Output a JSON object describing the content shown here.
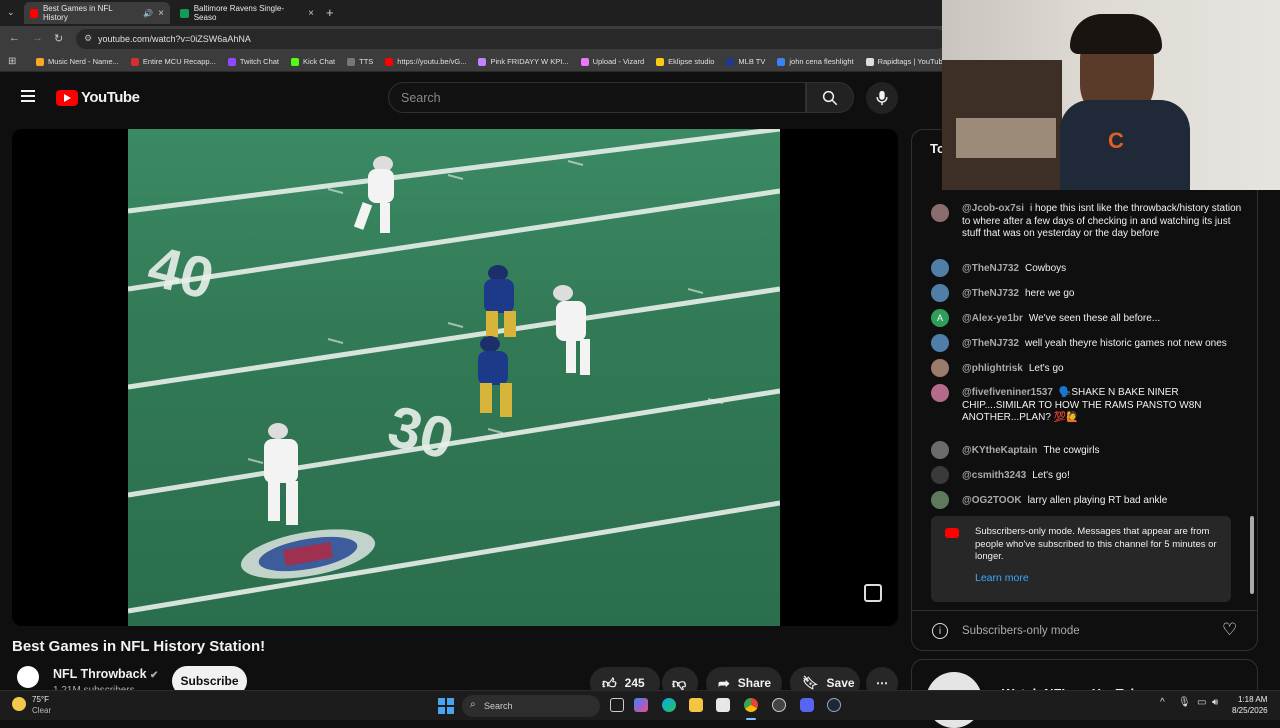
{
  "browser": {
    "tabs": [
      {
        "label": "Best Games in NFL History",
        "active": true
      },
      {
        "label": "Baltimore Ravens Single-Seaso",
        "active": false
      }
    ],
    "url": "youtube.com/watch?v=0iZSW6aAhNA",
    "bookmarks": [
      "Music Nerd - Name...",
      "Entire MCU Recapp...",
      "Twitch Chat",
      "Kick Chat",
      "TTS",
      "https://youtu.be/vG...",
      "Pink FRIDAYY W KPI...",
      "Upload - Vizard",
      "Eklipse studio",
      "MLB TV",
      "john cena fleshlight",
      "Rapidtags | YouTub..."
    ]
  },
  "youtube": {
    "logo_text": "YouTube",
    "search_placeholder": "Search"
  },
  "video": {
    "title": "Best Games in NFL History Station!",
    "channel": "NFL Throwback",
    "subscribers": "1.21M subscribers",
    "subscribe_label": "Subscribe",
    "likes": "245",
    "share_label": "Share",
    "save_label": "Save"
  },
  "chat": {
    "header_partial": "To",
    "messages": [
      {
        "author": "@Jcob-ox7si",
        "text": "i hope this isnt like the throwback/history station to where after a few days of checking in and watching its just stuff that was on yesterday or the day before"
      },
      {
        "author": "@TheNJ732",
        "text": "Cowboys"
      },
      {
        "author": "@TheNJ732",
        "text": "here we go"
      },
      {
        "author": "@Alex-ye1br",
        "text": "We've seen these all before..."
      },
      {
        "author": "@TheNJ732",
        "text": "well yeah theyre historic games not new ones"
      },
      {
        "author": "@phlightrisk",
        "text": "Let's go"
      },
      {
        "author": "@fivefiveniner1537",
        "text": "🗣️SHAKE N BAKE NINER CHIP....SIMILAR TO HOW THE RAMS PANSTO W8N ANOTHER...PLAN? 💯🙋"
      },
      {
        "author": "@KYtheKaptain",
        "text": "The cowgirls"
      },
      {
        "author": "@csmith3243",
        "text": "Let's go!"
      },
      {
        "author": "@OG2TOOK",
        "text": "larry allen playing RT bad ankle"
      }
    ],
    "notice": "Subscribers-only mode. Messages that appear are from people who've subscribed to this channel for 5 minutes or longer.",
    "learn_more": "Learn more",
    "footer_label": "Subscribers-only mode",
    "next_card_partial": "Watch NFL on YouTube"
  },
  "taskbar": {
    "weather_temp": "75°F",
    "weather_cond": "Clear",
    "search_label": "Search",
    "time": "1:18 AM",
    "date": "8/25/2026"
  }
}
